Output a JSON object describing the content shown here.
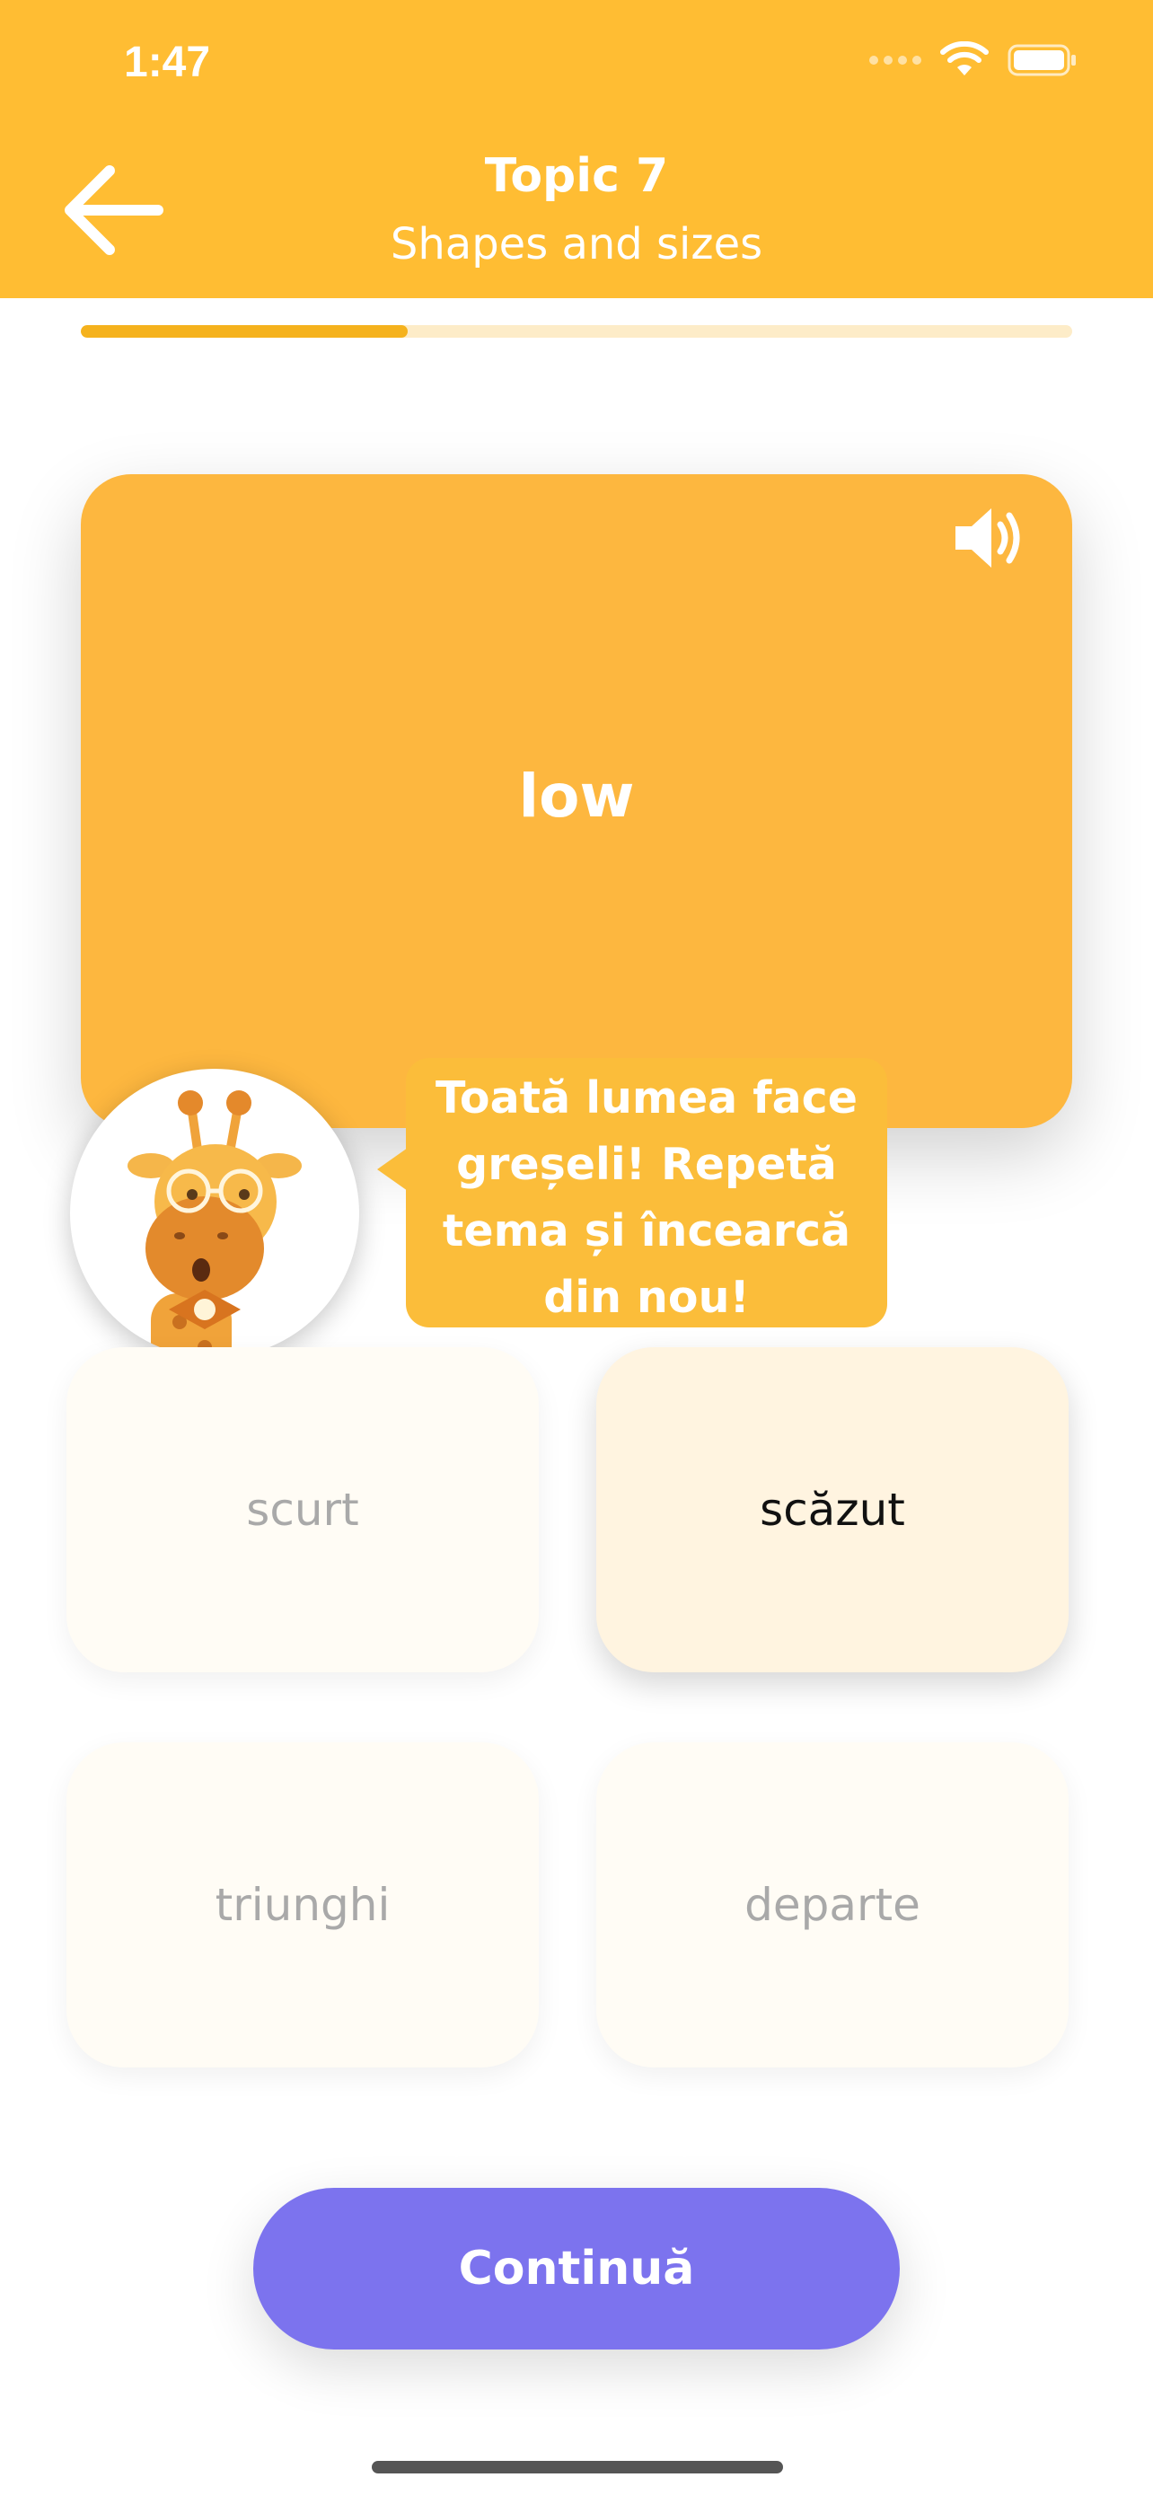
{
  "status_bar": {
    "time": "1:47"
  },
  "header": {
    "title": "Topic 7",
    "subtitle": "Shapes and sizes"
  },
  "progress": {
    "fraction": 0.33
  },
  "card": {
    "word": "low"
  },
  "mascot": {
    "message_lines": [
      "Toată lumea face",
      "greșeli! Repetă",
      "tema și încearcă",
      "din nou!"
    ]
  },
  "options": [
    {
      "label": "scurt",
      "selected": false
    },
    {
      "label": "scăzut",
      "selected": true
    },
    {
      "label": "triunghi",
      "selected": false
    },
    {
      "label": "departe",
      "selected": false
    }
  ],
  "continue_button": {
    "label": "Continuă"
  },
  "colors": {
    "header": "#ffbd33",
    "card": "#fdb73f",
    "accent_button": "#7c73ee",
    "progress_fill": "#f5b21d",
    "progress_track": "#fdecc8"
  }
}
